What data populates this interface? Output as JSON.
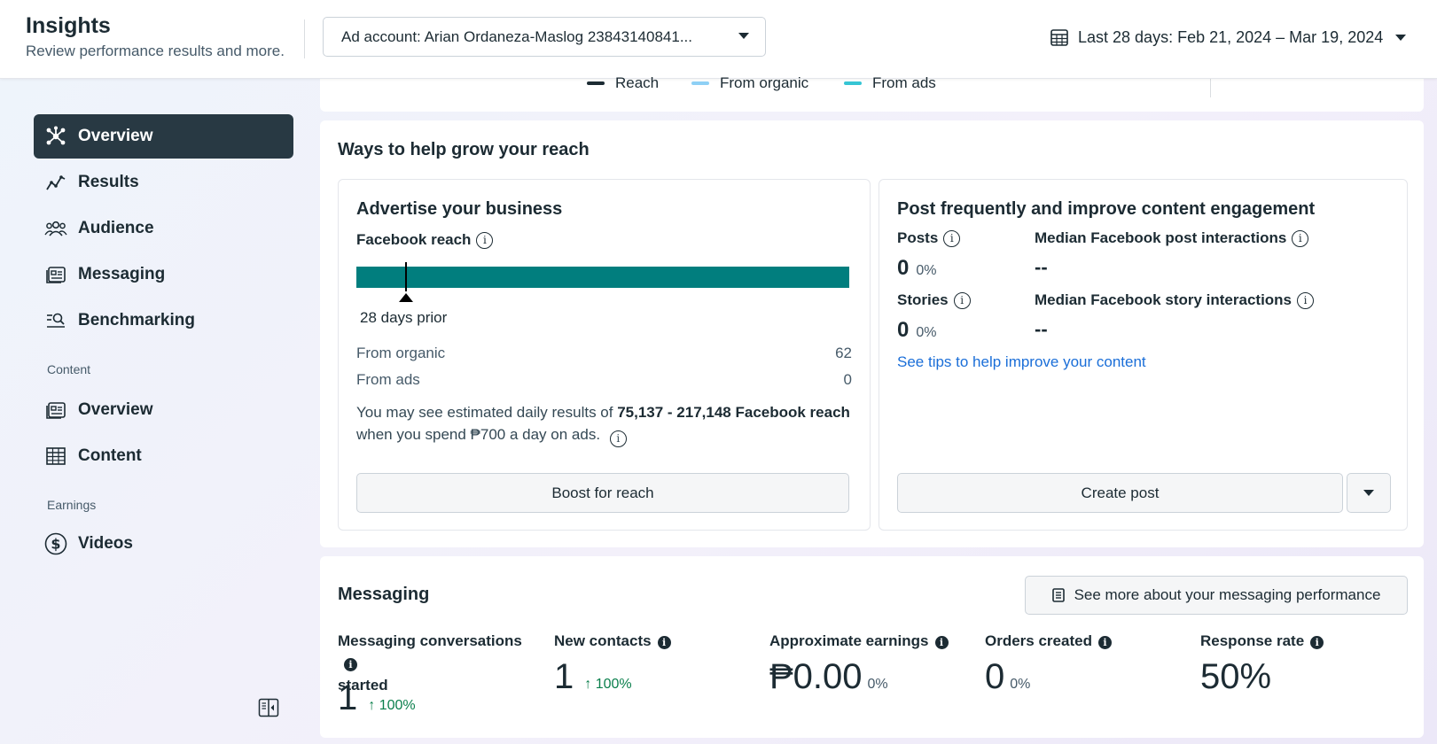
{
  "header": {
    "title": "Insights",
    "subtitle": "Review performance results and more.",
    "ad_account": "Ad account: Arian Ordaneza-Maslog 23843140841...",
    "date_range": "Last 28 days: Feb 21, 2024 – Mar 19, 2024"
  },
  "sidebar": {
    "items": [
      {
        "label": "Overview",
        "icon": "overview-icon"
      },
      {
        "label": "Results",
        "icon": "results-icon"
      },
      {
        "label": "Audience",
        "icon": "audience-icon"
      },
      {
        "label": "Messaging",
        "icon": "messaging-icon"
      },
      {
        "label": "Benchmarking",
        "icon": "benchmarking-icon"
      }
    ],
    "content_section": "Content",
    "content_items": [
      {
        "label": "Overview",
        "icon": "content-overview-icon"
      },
      {
        "label": "Content",
        "icon": "table-icon"
      }
    ],
    "earnings_section": "Earnings",
    "earnings_items": [
      {
        "label": "Videos",
        "icon": "dollar-icon"
      }
    ]
  },
  "legend": {
    "items": [
      {
        "label": "Reach",
        "color": "#1c2b33"
      },
      {
        "label": "From organic",
        "color": "#8ed0f5"
      },
      {
        "label": "From ads",
        "color": "#36c5d4"
      }
    ]
  },
  "grow": {
    "title": "Ways to help grow your reach",
    "advertise": {
      "title": "Advertise your business",
      "reach_label": "Facebook reach",
      "bar_color": "#017e7e",
      "marker_fraction": 0.1,
      "marker_label": "28 days prior",
      "from_organic_label": "From organic",
      "from_organic_value": "62",
      "from_ads_label": "From ads",
      "from_ads_value": "0",
      "estimate_prefix": "You may see estimated daily results of",
      "estimate_value": "75,137 - 217,148 Facebook reach",
      "estimate_suffix": "when you spend ₱700 a day on ads.",
      "boost_label": "Boost for reach"
    },
    "post": {
      "title": "Post frequently and improve content engagement",
      "posts_label": "Posts",
      "posts_value": "0",
      "posts_pct": "0%",
      "median_post_label": "Median Facebook post interactions",
      "median_post_value": "--",
      "stories_label": "Stories",
      "stories_value": "0",
      "stories_pct": "0%",
      "median_story_label": "Median Facebook story interactions",
      "median_story_value": "--",
      "tips_link": "See tips to help improve your content",
      "create_label": "Create post"
    }
  },
  "messaging": {
    "title": "Messaging",
    "see_more": "See more about your messaging performance",
    "metrics": [
      {
        "label_line1": "Messaging conversations",
        "label_line2": "started",
        "value": "1",
        "change": "100%"
      },
      {
        "label": "New contacts",
        "value": "1",
        "change": "100%"
      },
      {
        "label": "Approximate earnings",
        "value": "₱0.00",
        "pct": "0%"
      },
      {
        "label": "Orders created",
        "value": "0",
        "pct": "0%"
      },
      {
        "label": "Response rate",
        "value": "50%"
      }
    ]
  }
}
